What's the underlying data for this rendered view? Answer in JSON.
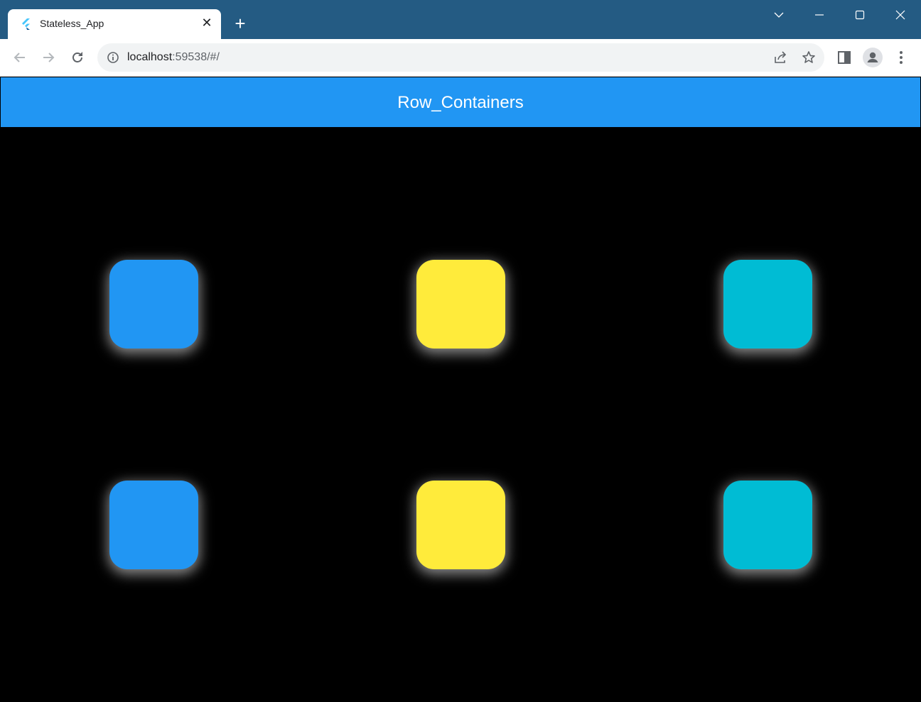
{
  "browser": {
    "tab_title": "Stateless_App",
    "tab_close_glyph": "✕",
    "new_tab_glyph": "+",
    "url_host": "localhost",
    "url_rest": ":59538/#/",
    "colors": {
      "frame": "#245b83",
      "toolbar": "#ffffff",
      "omnibox": "#f1f3f4"
    }
  },
  "app": {
    "title": "Row_Containers",
    "appbar_color": "#2196f3",
    "background": "#000000",
    "rows": [
      {
        "boxes": [
          {
            "color": "#2196f3"
          },
          {
            "color": "#ffeb3b"
          },
          {
            "color": "#00bcd4"
          }
        ]
      },
      {
        "boxes": [
          {
            "color": "#2196f3"
          },
          {
            "color": "#ffeb3b"
          },
          {
            "color": "#00bcd4"
          }
        ]
      }
    ]
  },
  "icons": {
    "tab_favicon": "flutter-icon",
    "back": "arrow-left-icon",
    "forward": "arrow-right-icon",
    "reload": "reload-icon",
    "info": "info-icon",
    "share": "share-icon",
    "bookmark": "star-icon",
    "side_panel": "side-panel-icon",
    "profile": "profile-icon",
    "menu": "kebab-menu-icon",
    "tab_search": "chevron-down-icon",
    "minimize": "minimize-icon",
    "maximize": "maximize-icon",
    "close": "close-icon"
  }
}
